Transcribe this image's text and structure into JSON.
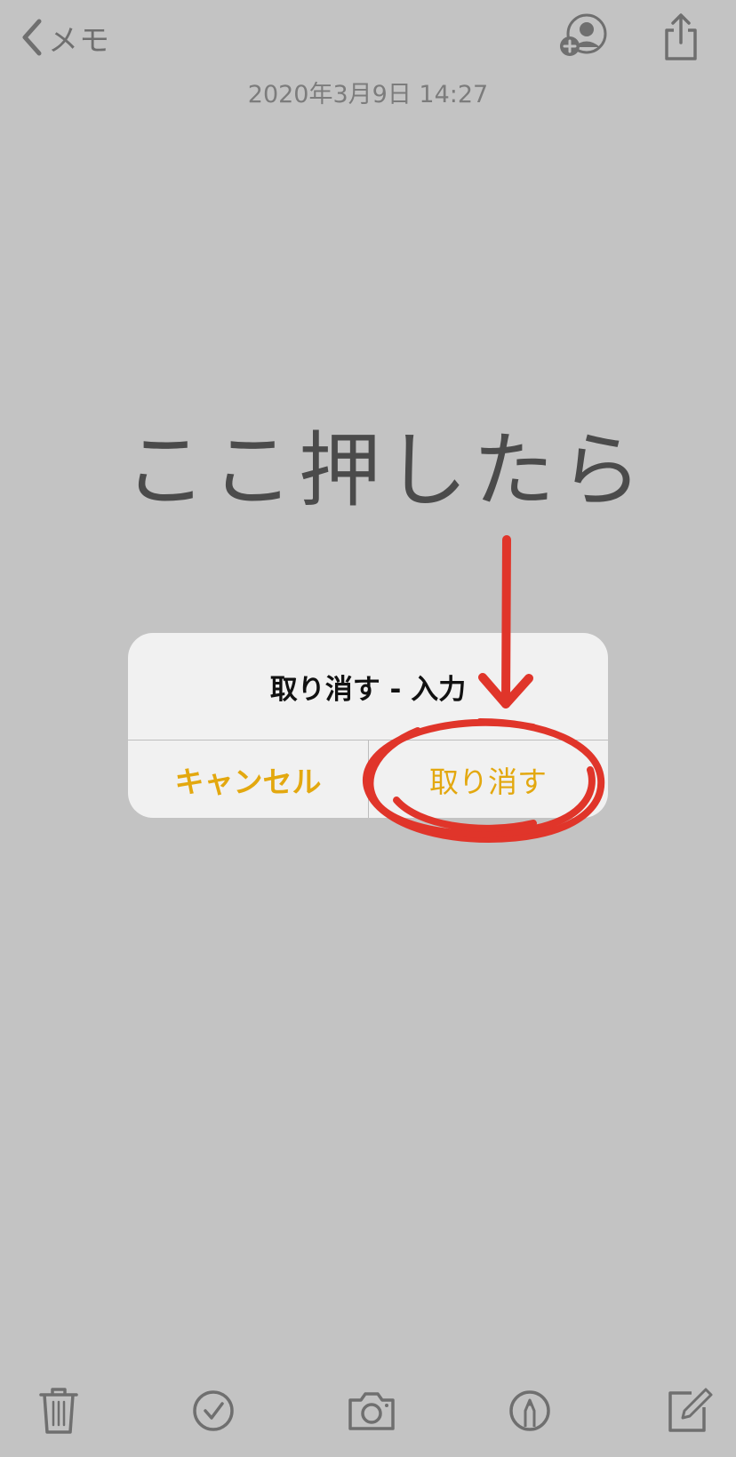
{
  "nav": {
    "back_label": "メモ",
    "icons": [
      "chevron-left-icon",
      "add-person-icon",
      "share-icon"
    ]
  },
  "note": {
    "date": "2020年3月9日 14:27",
    "handwritten_text": "ここ押したら"
  },
  "alert": {
    "title": "取り消す - 入力",
    "cancel_label": "キャンセル",
    "undo_label": "取り消す",
    "button_color": "#e3a80f"
  },
  "annotation": {
    "color": "#e0352a",
    "shapes": [
      "arrow-down",
      "circle"
    ]
  },
  "toolbar": {
    "icons": [
      "trash-icon",
      "checklist-icon",
      "camera-icon",
      "markup-pen-icon",
      "compose-icon"
    ]
  },
  "colors": {
    "background": "#c3c3c3",
    "accent": "#e3a80f",
    "annotation_red": "#e0352a"
  }
}
